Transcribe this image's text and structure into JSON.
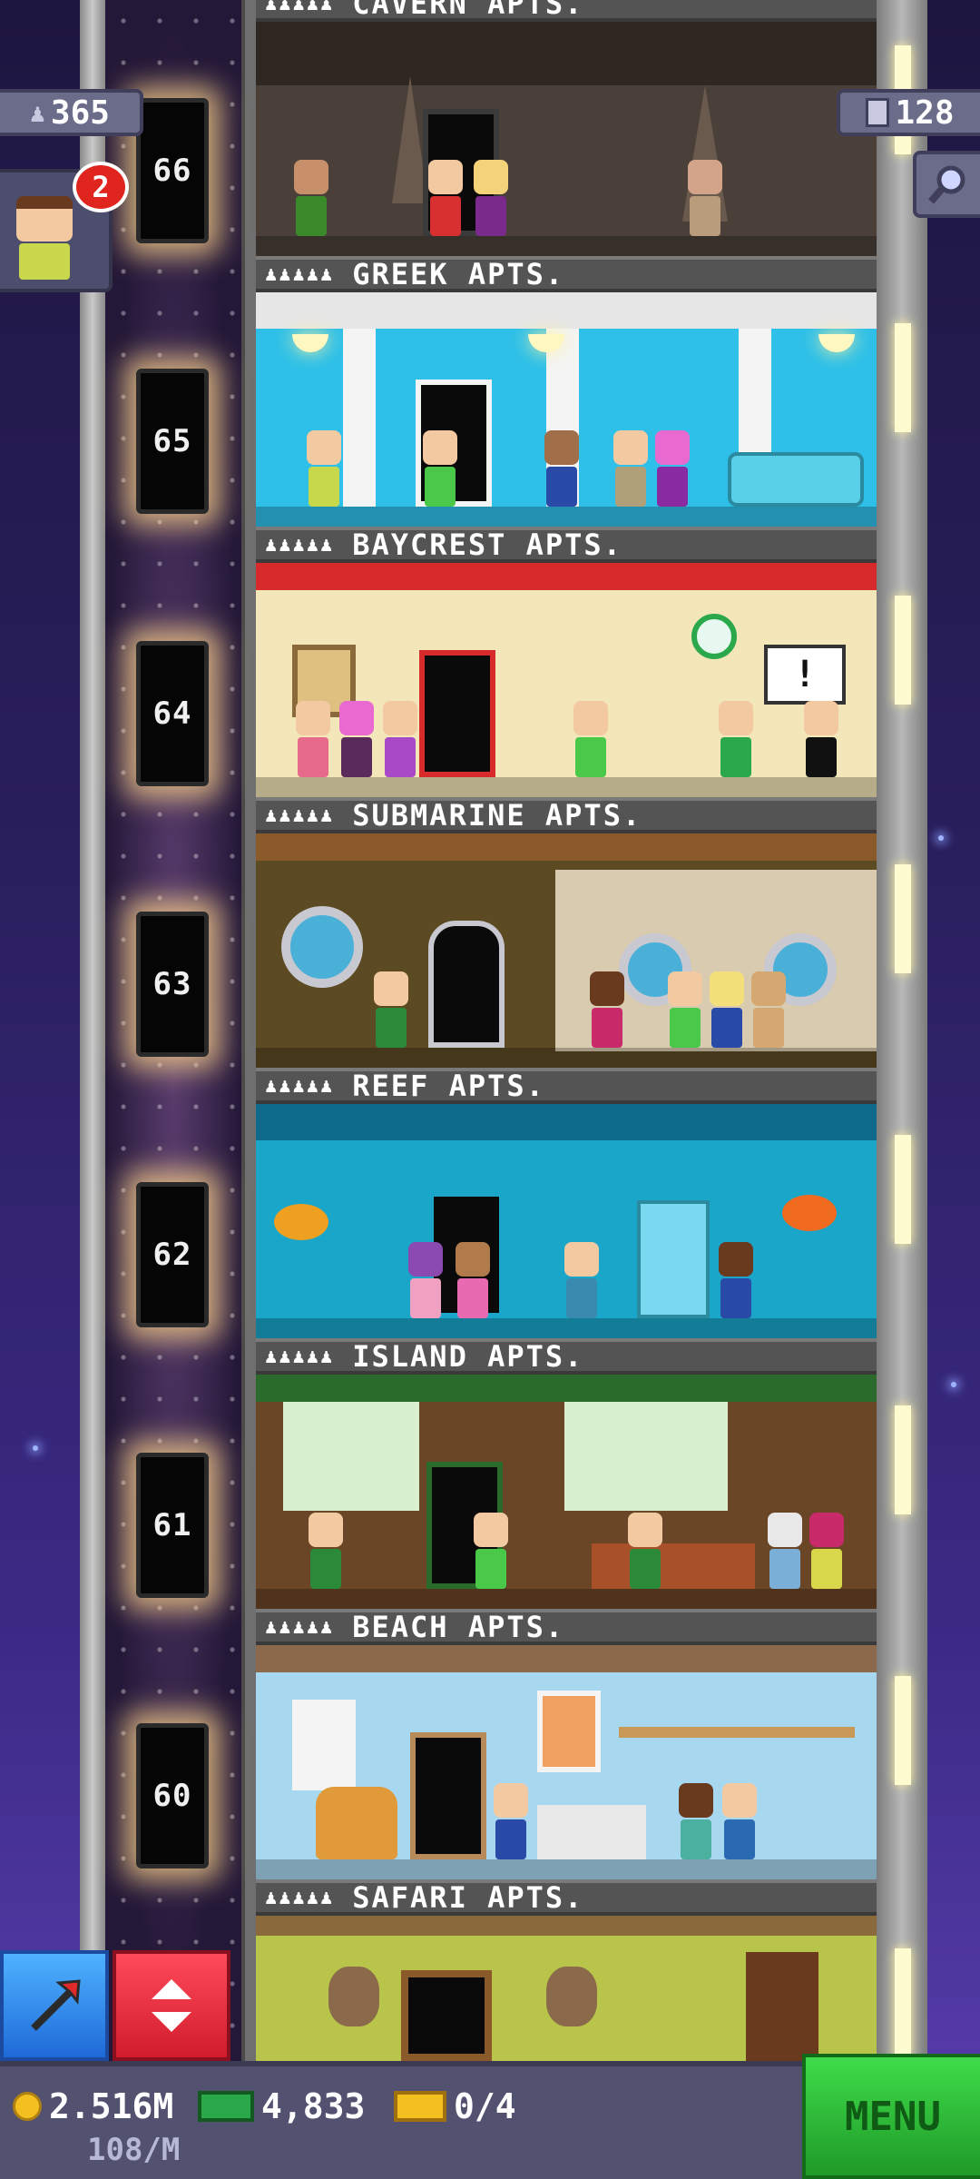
{
  "hud": {
    "population": "365",
    "floors_count": "128",
    "visitor_notifications": "2"
  },
  "floors": [
    {
      "number": "66",
      "name": "CAVERN APTS.",
      "people_icons": "♟♟♟♟♟",
      "bg": "#4a4039"
    },
    {
      "number": "65",
      "name": "GREEK APTS.",
      "people_icons": "♟♟♟♟♟",
      "bg": "#2ec0e8"
    },
    {
      "number": "64",
      "name": "BAYCREST APTS.",
      "people_icons": "♟♟♟♟♟",
      "bg": "#f3e6b8"
    },
    {
      "number": "63",
      "name": "SUBMARINE APTS.",
      "people_icons": "♟♟♟♟♟",
      "bg": "#5c4a22"
    },
    {
      "number": "62",
      "name": "REEF APTS.",
      "people_icons": "♟♟♟♟♟",
      "bg": "#1aa6c9"
    },
    {
      "number": "61",
      "name": "ISLAND APTS.",
      "people_icons": "♟♟♟♟♟",
      "bg": "#6a4526"
    },
    {
      "number": "60",
      "name": "BEACH APTS.",
      "people_icons": "♟♟♟♟♟",
      "bg": "#a8d8f0"
    },
    {
      "number": "",
      "name": "SAFARI APTS.",
      "people_icons": "♟♟♟♟♟",
      "bg": "#b9c44a"
    }
  ],
  "bottom_bar": {
    "coins": "2.516M",
    "coin_rate": "108/M",
    "bux": "4,833",
    "tickets": "0/4",
    "menu_label": "MENU"
  },
  "colors": {
    "menu_green": "#2fc23a",
    "elevator_red": "#e0283a",
    "pick_blue": "#2e86e8",
    "hud_panel": "#6b6b8a"
  },
  "icons": {
    "population": "person-icon",
    "floors": "building-icon",
    "search": "magnifier-icon",
    "coins": "coin-icon",
    "bux": "bux-bill-icon",
    "tickets": "ticket-icon",
    "pick": "pickaxe-icon",
    "elevator": "elevator-arrows-icon"
  }
}
